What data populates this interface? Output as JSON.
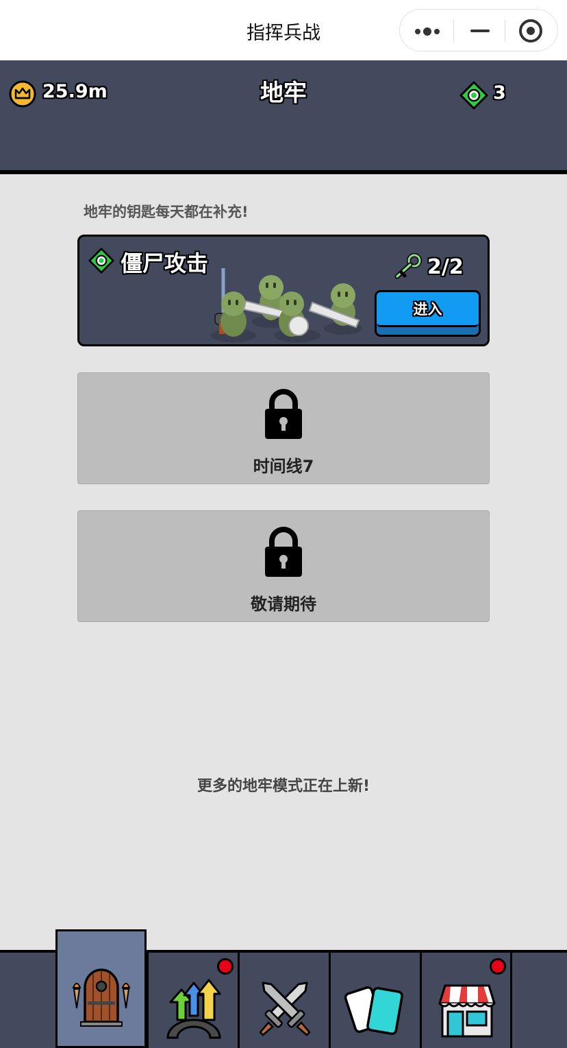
{
  "window": {
    "title": "指挥兵战",
    "capsule": {
      "more_icon": "more-dots-icon",
      "minimize_icon": "minimize-icon",
      "close_icon": "target-close-icon"
    }
  },
  "header": {
    "gold": "25.9m",
    "title": "地牢",
    "gems": "3",
    "colors": {
      "bar": "#434a5e",
      "crown": "#f3b830",
      "gem": "#2ecc40"
    }
  },
  "notice": "地牢的钥匙每天都在补充!",
  "dungeons": [
    {
      "title": "僵尸攻击",
      "keys": "2/2",
      "enter_label": "进入",
      "icon": "gem-icon",
      "art": "zombie-horde"
    },
    {
      "label": "时间线7",
      "locked": true,
      "icon": "padlock-icon"
    },
    {
      "label": "敬请期待",
      "locked": true,
      "icon": "padlock-icon"
    }
  ],
  "footer_notice": "更多的地牢模式正在上新!",
  "bottom_nav": {
    "tabs": [
      {
        "icon": "dungeon-door-icon",
        "active": true,
        "badge": false
      },
      {
        "icon": "upgrade-arrows-icon",
        "active": false,
        "badge": true
      },
      {
        "icon": "crossed-swords-icon",
        "active": false,
        "badge": false
      },
      {
        "icon": "cards-icon",
        "active": false,
        "badge": false
      },
      {
        "icon": "shop-icon",
        "active": false,
        "badge": true
      }
    ],
    "badge_color": "#e80018",
    "active_color": "#6c7a9c"
  }
}
